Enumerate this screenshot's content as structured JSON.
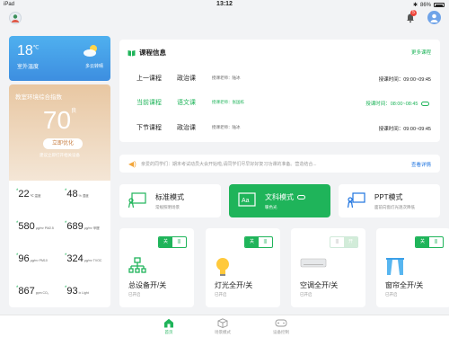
{
  "status_bar": {
    "device": "iPad",
    "time": "13:12",
    "battery": "86%"
  },
  "header": {
    "notification_count": "5"
  },
  "weather": {
    "temperature": "18",
    "unit": "℃",
    "label": "室外温度",
    "condition": "多云转晴"
  },
  "environment": {
    "title": "教室环境综合指数",
    "score": "70",
    "grade": "良",
    "optimize_label": "立即优化",
    "tip": "建议立即打开相关设备",
    "metrics": [
      {
        "value": "22",
        "unit": "℃",
        "name": "温度"
      },
      {
        "value": "48",
        "unit": "%",
        "name": "湿度"
      },
      {
        "value": "580",
        "unit": "μg/m³",
        "name": "PM2.5"
      },
      {
        "value": "689",
        "unit": "μg/m³",
        "name": "甲醛"
      },
      {
        "value": "96",
        "unit": "μg/m³",
        "name": "PM10"
      },
      {
        "value": "324",
        "unit": "μg/m³",
        "name": "TVOC"
      },
      {
        "value": "867",
        "unit": "ppm",
        "name": "CO₂"
      },
      {
        "value": "93",
        "unit": "lx",
        "name": "Light"
      }
    ]
  },
  "course": {
    "title": "课程信息",
    "more": "更多课程",
    "rows": [
      {
        "slot": "上一课程",
        "subject": "政治课",
        "teacher": "授课老师：陆冰",
        "time": "授课时间：09:00~09:45"
      },
      {
        "slot": "当前课程",
        "subject": "语文课",
        "teacher": "授课老师：张国栋",
        "time": "授课时间：08:00~08:45"
      },
      {
        "slot": "下节课程",
        "subject": "政治课",
        "teacher": "授课老师：陆冰",
        "time": "授课时间：09:00~09:45"
      }
    ]
  },
  "notice": {
    "text": "亲爱的同学们：期末考试动员大会开始啦,请同学们尽早好好复习功课的准备。营造结合...",
    "more": "查看详情"
  },
  "modes": [
    {
      "title": "标准模式",
      "subtitle": "常规照明场景"
    },
    {
      "title": "文科模式",
      "subtitle": "暖色光"
    },
    {
      "title": "PPT模式",
      "subtitle": "面前向窗灯光逐次降低"
    }
  ],
  "devices": [
    {
      "title": "总设备开/关",
      "status": "已开启",
      "toggle_on": "关",
      "toggle_off": "|||"
    },
    {
      "title": "灯光全开/关",
      "status": "已开启",
      "toggle_on": "关",
      "toggle_off": "|||"
    },
    {
      "title": "空调全开/关",
      "status": "已开启",
      "toggle_on": "开",
      "toggle_off": "|||"
    },
    {
      "title": "窗帘全开/关",
      "status": "已开启",
      "toggle_on": "关",
      "toggle_off": "|||"
    }
  ],
  "tabs": [
    {
      "label": "首页",
      "icon": "home-icon"
    },
    {
      "label": "场景模式",
      "icon": "cube-icon"
    },
    {
      "label": "设备控制",
      "icon": "gamepad-icon"
    }
  ],
  "colors": {
    "accent": "#1fb45a",
    "weather_blue": "#3d8ee0",
    "env_tan": "#e8c7a2",
    "badge_red": "#f0453a"
  }
}
